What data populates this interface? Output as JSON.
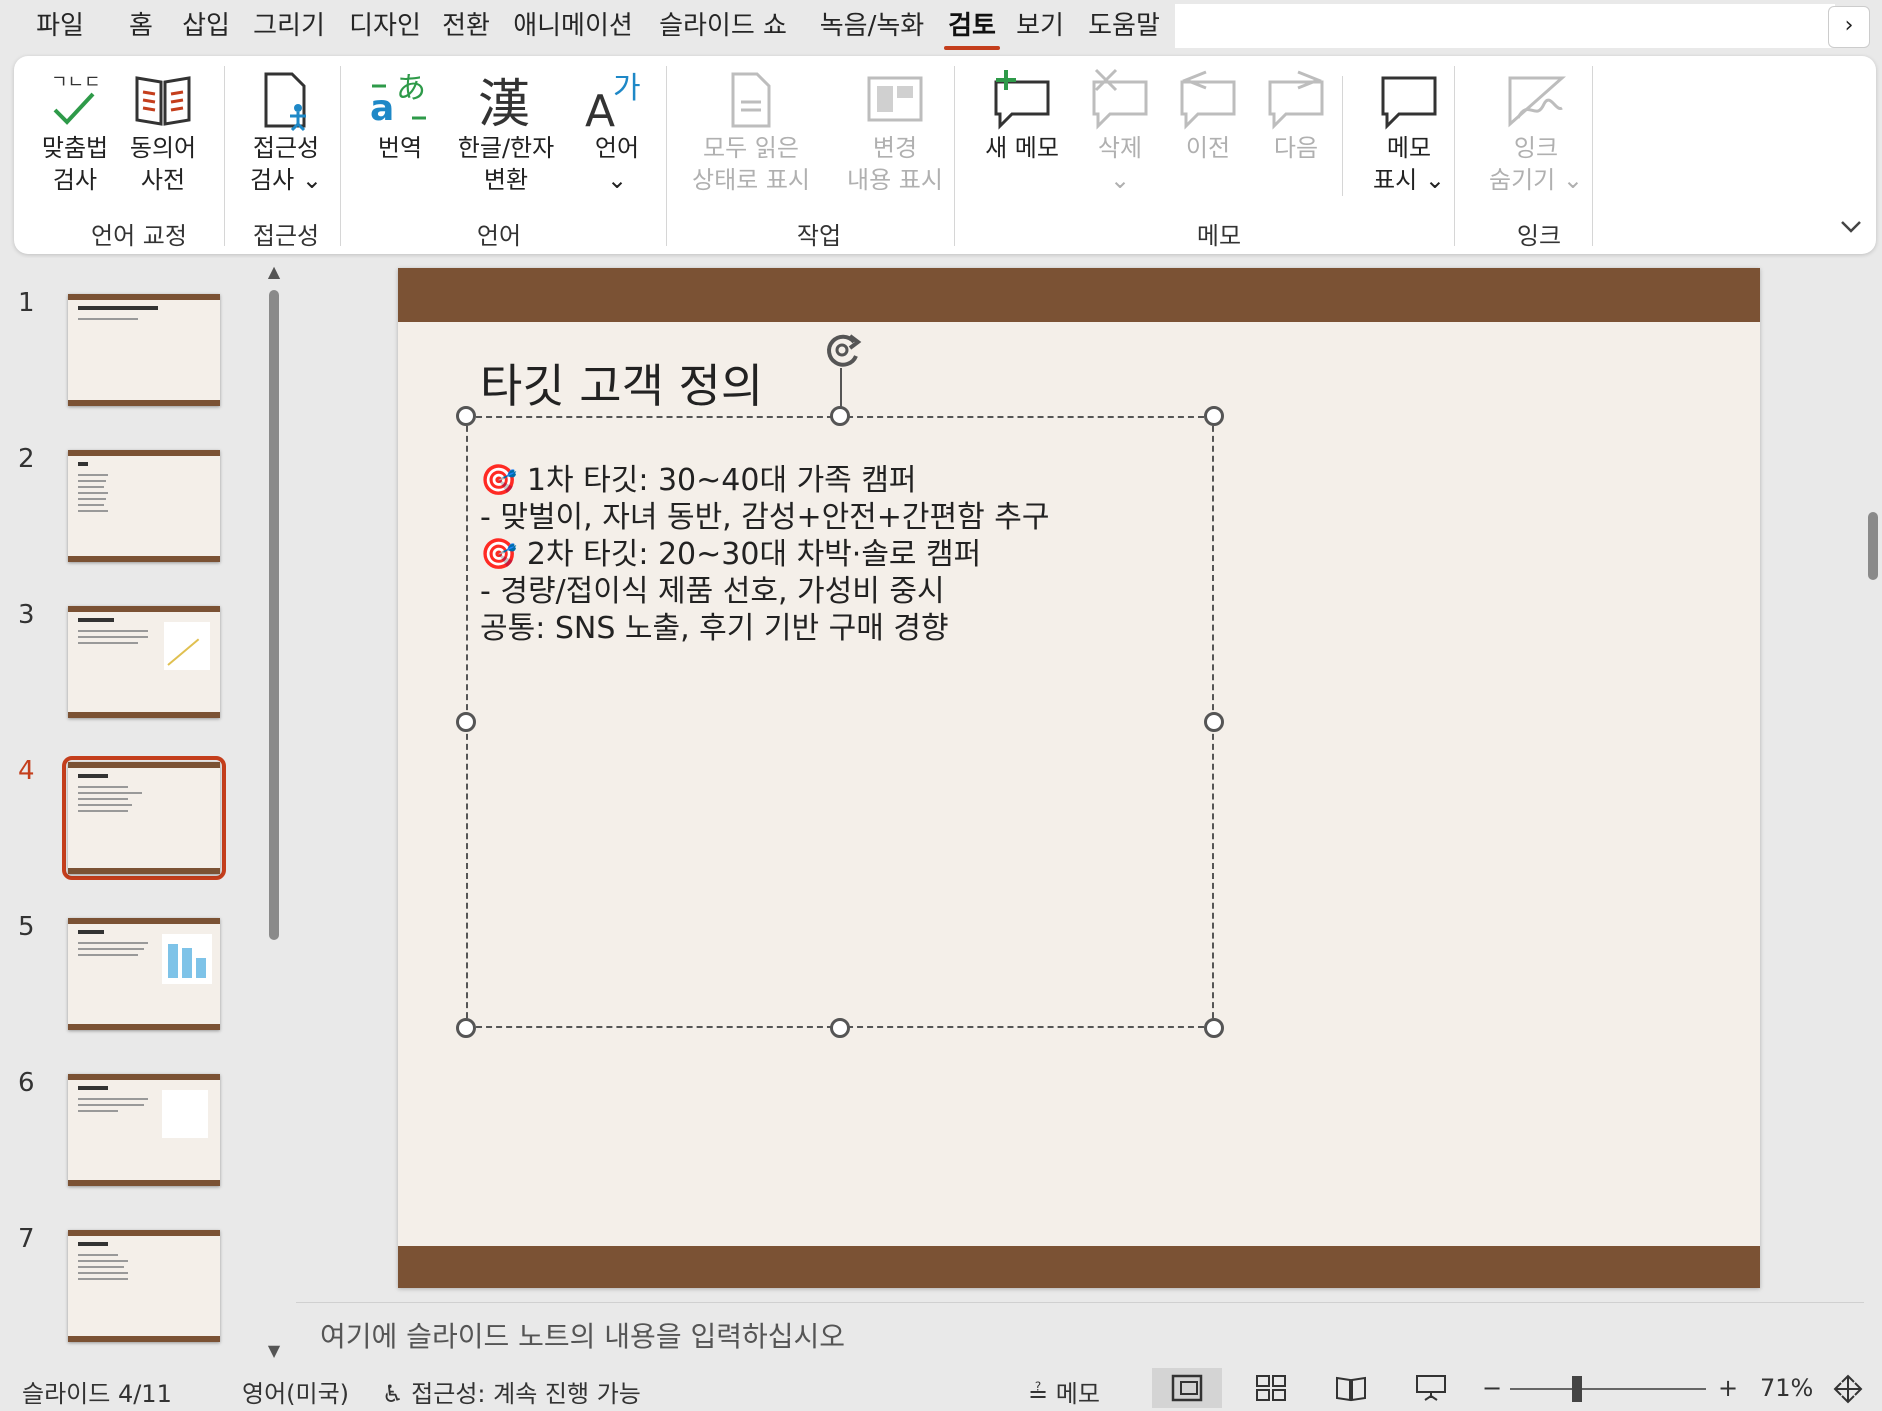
{
  "tabs": [
    "파일",
    "홈",
    "삽입",
    "그리기",
    "디자인",
    "전환",
    "애니메이션",
    "슬라이드 쇼",
    "녹음/녹화",
    "검토",
    "보기",
    "도움말"
  ],
  "tab_scroll_glyph": "›",
  "ribbon": {
    "spell": "맞춤법\n검사",
    "thesaurus": "동의어\n사전",
    "access_check": "접근성\n검사 ⌄",
    "translate": "번역",
    "hanja": "한글/한자\n변환",
    "language": "언어\n⌄",
    "show_all_read": "모두 읽은\n상태로 표시",
    "changes": "변경\n내용 표시",
    "new_comment": "새 메모",
    "delete": "삭제\n⌄",
    "prev": "이전",
    "next": "다음",
    "show_comments": "메모\n표시 ⌄",
    "hide_ink": "잉크\n숨기기 ⌄",
    "groups": {
      "proofing": "언어 교정",
      "accessibility": "접근성",
      "language": "언어",
      "activity": "작업",
      "comments": "메모",
      "ink": "잉크"
    },
    "icons": {
      "hanja_glyph": "漢",
      "lang_a": "A",
      "lang_ga": "가",
      "trans_a": "a",
      "trans_ah": "あ"
    }
  },
  "thumbnails": [
    "1",
    "2",
    "3",
    "4",
    "5",
    "6",
    "7"
  ],
  "active_slide": "4",
  "slide": {
    "title": "타깃 고객 정의",
    "lines": [
      "🎯 1차 타깃: 30~40대 가족 캠퍼",
      "- 맞벌이, 자녀 동반, 감성+안전+간편함 추구",
      "🎯 2차 타깃: 20~30대 차박·솔로 캠퍼",
      "- 경량/접이식 제품 선호, 가성비 중시",
      "공통: SNS 노출, 후기 기반 구매 경향"
    ]
  },
  "notes_placeholder": "여기에 슬라이드 노트의 내용을 입력하십시오",
  "status": {
    "slide_count": "슬라이드 4/11",
    "language": "영어(미국)",
    "accessibility": "접근성: 계속 진행 가능",
    "notes_btn": "메모",
    "zoom_minus": "−",
    "zoom_plus": "+",
    "zoom_level": "71%"
  },
  "colors": {
    "accent": "#c43e1c",
    "slide_band": "#7b5234",
    "slide_bg": "#f4efe9"
  }
}
